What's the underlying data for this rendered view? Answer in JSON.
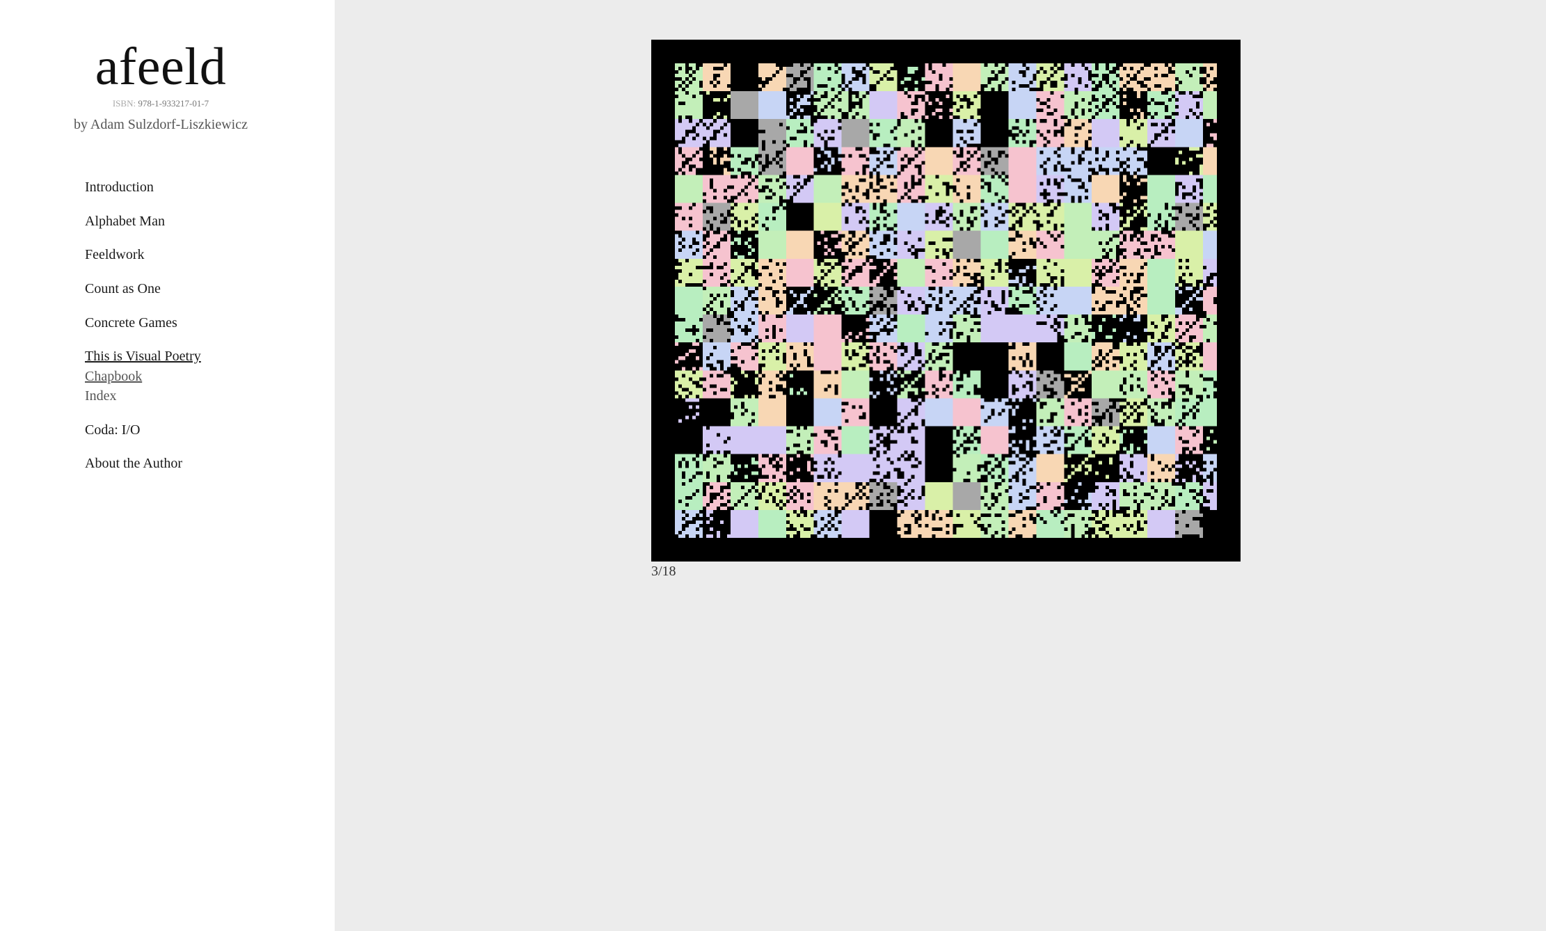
{
  "site": {
    "title": "afeeld",
    "isbn_label": "ISBN:",
    "isbn_value": "978-1-933217-01-7",
    "author": "by Adam Sulzdorf-Liszkiewicz"
  },
  "nav": {
    "items": [
      {
        "label": "Introduction"
      },
      {
        "label": "Alphabet Man"
      },
      {
        "label": "Feeldwork"
      },
      {
        "label": "Count as One"
      },
      {
        "label": "Concrete Games"
      },
      {
        "label": "This is Visual Poetry"
      },
      {
        "label": "Chapbook"
      },
      {
        "label": "Index"
      },
      {
        "label": "Coda: I/O"
      },
      {
        "label": "About the Author"
      }
    ],
    "active": "This is Visual Poetry",
    "active_sub": "Chapbook"
  },
  "viewer": {
    "page_counter": "3/18",
    "current_page": 3,
    "total_pages": 18,
    "image_description_icon": "pixel-glyph-mosaic",
    "tiles": [
      {
        "text": "2",
        "color": "#000000"
      },
      {
        "text": "1",
        "color": "#000000"
      },
      {
        "text": "3",
        "color": "#000000"
      }
    ],
    "colors": {
      "pink": "#f6c3cf",
      "peach": "#f8d7b4",
      "green": "#c3efb9",
      "lightgreen": "#b8eec0",
      "lavender": "#d3c9f5",
      "blue": "#c7d5f5",
      "yellowgreen": "#d9f0a8",
      "gray": "#a8a8a8",
      "black": "#000000",
      "frame": "#000000"
    }
  }
}
